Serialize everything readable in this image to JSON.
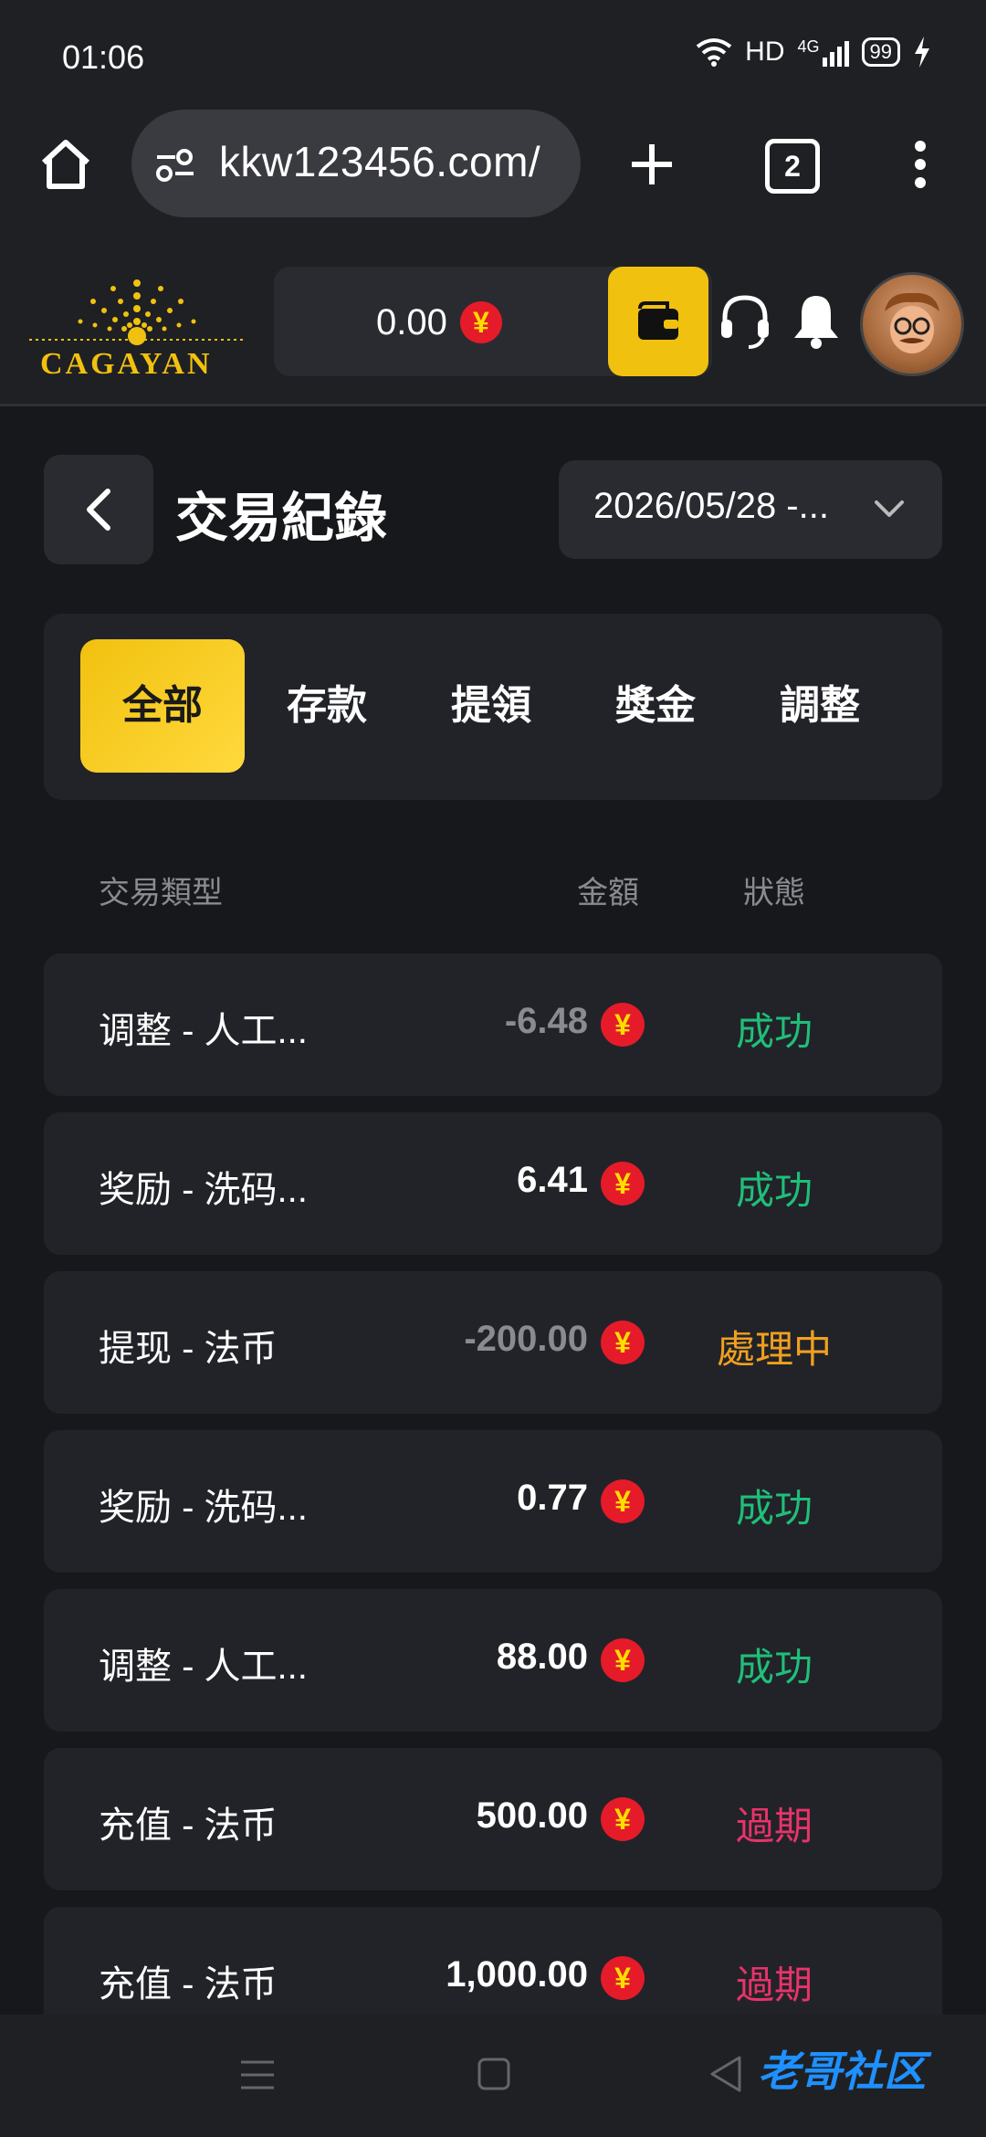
{
  "status_bar": {
    "time": "01:06",
    "network_label": "HD",
    "signal_label": "4G",
    "battery": "99"
  },
  "browser": {
    "url": "kkw123456.com/",
    "tab_count": "2"
  },
  "app_header": {
    "logo_text": "CAGAYAN",
    "balance": "0.00",
    "currency_symbol": "¥"
  },
  "page": {
    "title": "交易紀錄",
    "date_range": "2026/05/28 -..."
  },
  "tabs": [
    {
      "label": "全部",
      "active": true
    },
    {
      "label": "存款",
      "active": false
    },
    {
      "label": "提領",
      "active": false
    },
    {
      "label": "獎金",
      "active": false
    },
    {
      "label": "調整",
      "active": false
    }
  ],
  "columns": {
    "type": "交易類型",
    "amount": "金額",
    "status": "狀態"
  },
  "transactions": [
    {
      "type": "调整 - 人工...",
      "amount": "-6.48",
      "status": "成功"
    },
    {
      "type": "奖励 - 洗码...",
      "amount": "6.41",
      "status": "成功"
    },
    {
      "type": "提现 - 法币",
      "amount": "-200.00",
      "status": "處理中"
    },
    {
      "type": "奖励 - 洗码...",
      "amount": "0.77",
      "status": "成功"
    },
    {
      "type": "调整 - 人工...",
      "amount": "88.00",
      "status": "成功"
    },
    {
      "type": "充值 - 法币",
      "amount": "500.00",
      "status": "過期"
    },
    {
      "type": "充值 - 法币",
      "amount": "1,000.00",
      "status": "過期"
    }
  ],
  "watermark": "老哥社区",
  "colors": {
    "accent": "#f1c10f",
    "success": "#1fbf7a",
    "pending": "#f0a020",
    "expired": "#e8336a",
    "negative": "#8a8b90"
  }
}
